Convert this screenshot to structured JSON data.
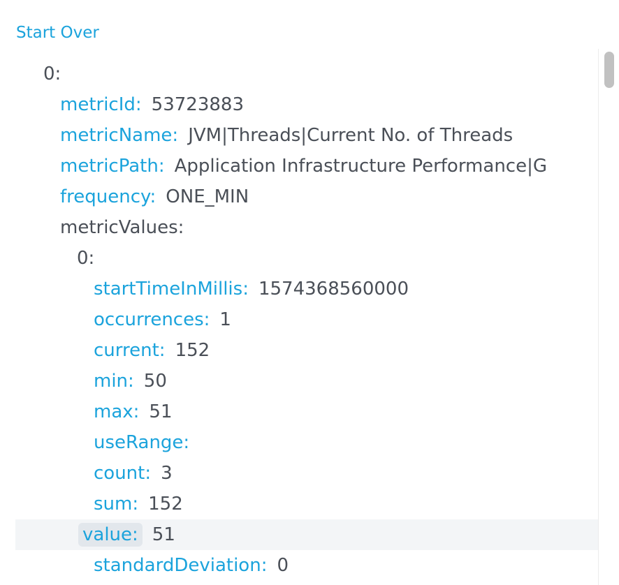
{
  "header": {
    "start_over_label": "Start Over"
  },
  "tree": {
    "root_index": "0:",
    "fields": {
      "metricId": {
        "key": "metricId:",
        "value": "53723883"
      },
      "metricName": {
        "key": "metricName:",
        "value": "JVM|Threads|Current No. of Threads"
      },
      "metricPath": {
        "key": "metricPath:",
        "value": "Application Infrastructure Performance|G"
      },
      "frequency": {
        "key": "frequency:",
        "value": "ONE_MIN"
      },
      "metricValues": {
        "key": "metricValues:"
      }
    },
    "metric_values_index": "0:",
    "metric_value_fields": {
      "startTimeInMillis": {
        "key": "startTimeInMillis:",
        "value": "1574368560000"
      },
      "occurrences": {
        "key": "occurrences:",
        "value": "1"
      },
      "current": {
        "key": "current:",
        "value": "152"
      },
      "min": {
        "key": "min:",
        "value": "50"
      },
      "max": {
        "key": "max:",
        "value": "51"
      },
      "useRange": {
        "key": "useRange:",
        "value": ""
      },
      "count": {
        "key": "count:",
        "value": "3"
      },
      "sum": {
        "key": "sum:",
        "value": "152"
      },
      "value": {
        "key": "value:",
        "value": "51"
      },
      "standardDeviation": {
        "key": "standardDeviation:",
        "value": "0"
      }
    }
  },
  "colors": {
    "key": "#1ba3dc",
    "value": "#4a4f57",
    "selected_row_bg": "#f3f5f7",
    "key_highlight_bg": "#e2e7ec"
  }
}
